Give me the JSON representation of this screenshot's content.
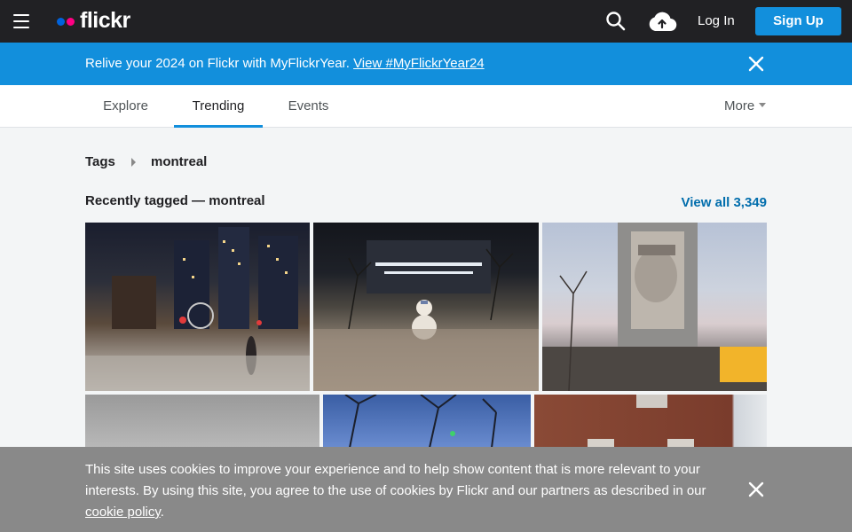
{
  "brand": {
    "name": "flickr"
  },
  "topnav": {
    "login_label": "Log In",
    "signup_label": "Sign Up"
  },
  "promo": {
    "text": "Relive your 2024 on Flickr with MyFlickrYear. ",
    "link_text": "View #MyFlickrYear24"
  },
  "subnav": {
    "tabs": [
      {
        "label": "Explore"
      },
      {
        "label": "Trending"
      },
      {
        "label": "Events"
      }
    ],
    "more_label": "More"
  },
  "breadcrumb": {
    "root": "Tags",
    "current": "montreal"
  },
  "section": {
    "title": "Recently tagged — montreal",
    "view_all": "View all 3,349"
  },
  "cookie": {
    "text": "This site uses cookies to improve your experience and to help show content that is more relevant to your interests. By using this site, you agree to the use of cookies by Flickr and our partners as described in our ",
    "link_text": "cookie policy",
    "suffix": "."
  },
  "colors": {
    "nav_bg": "#212124",
    "accent": "#128fdc",
    "link": "#006dac",
    "cookie_bg": "#898989",
    "brand_blue": "#0063dc",
    "brand_pink": "#ff0084"
  },
  "icons": [
    "menu-icon",
    "search-icon",
    "upload-cloud-icon",
    "close-icon",
    "caret-right-icon",
    "caret-down-icon"
  ]
}
